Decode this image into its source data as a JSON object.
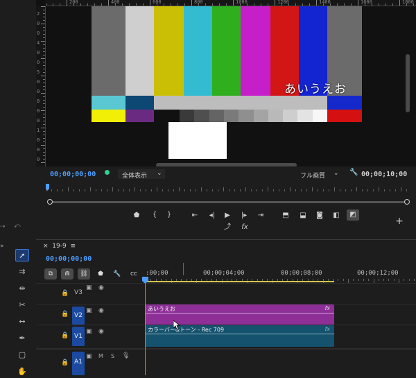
{
  "monitor": {
    "ruler_labels": [
      "200",
      "400",
      "600",
      "800",
      "1000",
      "1200",
      "1400",
      "1600",
      "1800"
    ],
    "vruler_labels": [
      "2",
      "0",
      "0",
      "4",
      "0",
      "0",
      "5",
      "0",
      "0",
      "8",
      "0",
      "0",
      "1",
      "0",
      "0",
      "0"
    ],
    "overlay_text": "あいうえお",
    "color_bars": [
      "#6b6b6b",
      "#cfcfcf",
      "#cbbf05",
      "#33bcd1",
      "#2fae1e",
      "#c51fc9",
      "#d21515",
      "#1324d1",
      "#6b6b6b"
    ],
    "timecode_current": "00;00;00;00",
    "zoom": "全体表示",
    "quality": "フル画質",
    "timecode_duration": "00;00;10;00"
  },
  "controls": {
    "add_label": "+",
    "fx_label": "fx"
  },
  "timeline": {
    "sequence_name": "19-9",
    "menu_icon": "≡",
    "close": "×",
    "timecode": "00;00;00;00",
    "ruler_labels": [
      ":00;00",
      "00;00;04;00",
      "00;00;08;00",
      "00;00;12;00"
    ],
    "tracks": [
      {
        "name": "V3",
        "selected": false
      },
      {
        "name": "V2",
        "selected": true
      },
      {
        "name": "V1",
        "selected": true
      },
      {
        "name": "A1",
        "selected": true
      }
    ],
    "a1_buttons": [
      "M",
      "S"
    ],
    "clips": [
      {
        "track": "V2",
        "label": "あいうえお",
        "color": "#8e2f98",
        "fx": "fx"
      },
      {
        "track": "V1",
        "label": "カラーバー&トーン - Rec 709",
        "color": "#15526e",
        "fx": "fx"
      }
    ]
  }
}
